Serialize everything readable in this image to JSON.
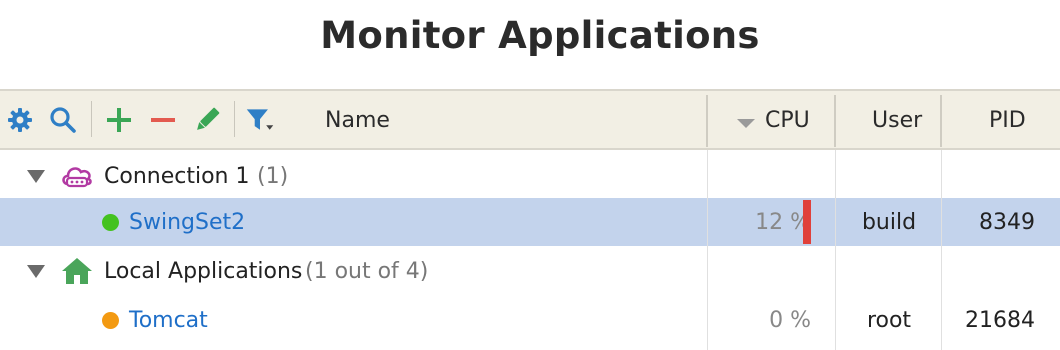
{
  "title": "Monitor Applications",
  "toolbar": {
    "icons": [
      "gear-icon",
      "search-icon",
      "plus-icon",
      "minus-icon",
      "pencil-icon",
      "filter-icon"
    ]
  },
  "columns": {
    "name": "Name",
    "cpu": "CPU",
    "user": "User",
    "pid": "PID"
  },
  "rows": [
    {
      "type": "group",
      "label": "Connection 1",
      "count": "(1)",
      "icon": "cloud-connection-icon"
    },
    {
      "type": "app",
      "name": "SwingSet2",
      "status_color": "#44c21f",
      "cpu": "12 %",
      "cpu_fraction": 0.12,
      "user": "build",
      "pid": "8349",
      "selected": true
    },
    {
      "type": "group",
      "label": "Local Applications",
      "count": "(1 out of 4)",
      "icon": "home-icon"
    },
    {
      "type": "app",
      "name": "Tomcat",
      "status_color": "#f39a12",
      "cpu": "0 %",
      "cpu_fraction": 0.0,
      "user": "root",
      "pid": "21684",
      "selected": false
    }
  ],
  "colors": {
    "accent_blue": "#2f7fc6",
    "add_green": "#3aa655",
    "remove_red": "#e35a4f",
    "cpu_bar": "#e0403a",
    "selection": "#c3d3ec"
  }
}
